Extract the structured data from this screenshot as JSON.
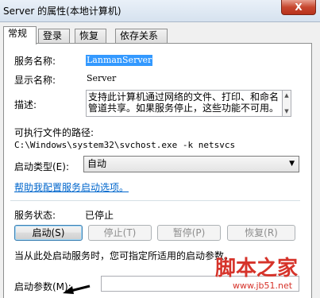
{
  "window": {
    "title": "Server 的属性(本地计算机)",
    "close_label": "X"
  },
  "tabs": [
    {
      "label": "常规",
      "active": true
    },
    {
      "label": "登录",
      "active": false
    },
    {
      "label": "恢复",
      "active": false
    },
    {
      "label": "依存关系",
      "active": false
    }
  ],
  "general": {
    "service_name_label": "服务名称:",
    "service_name_value": "LanmanServer",
    "display_name_label": "显示名称:",
    "display_name_value": "Server",
    "description_label": "描述:",
    "description_text": "支持此计算机通过网络的文件、打印、和命名管道共享。如果服务停止，这些功能不可用。",
    "exe_path_label": "可执行文件的路径:",
    "exe_path_value": "C:\\Windows\\system32\\svchost.exe -k netsvcs",
    "startup_type_label": "启动类型(E):",
    "startup_type_value": "自动",
    "help_link": "帮助我配置服务启动选项。",
    "status_label": "服务状态:",
    "status_value": "已停止",
    "buttons": {
      "start": "启动(S)",
      "stop": "停止(T)",
      "pause": "暂停(P)",
      "resume": "恢复(R)"
    },
    "hint_text": "当从此处启动服务时，您可指定所适用的启动参数。",
    "start_params_label": "启动参数(M):",
    "start_params_value": ""
  },
  "watermark": {
    "logo_text": "脚本之家",
    "url": "www.jb51.net"
  },
  "colors": {
    "selection": "#3399ff",
    "link": "#0066cc",
    "close_button": "#c7472f",
    "watermark": "#d6332a"
  }
}
